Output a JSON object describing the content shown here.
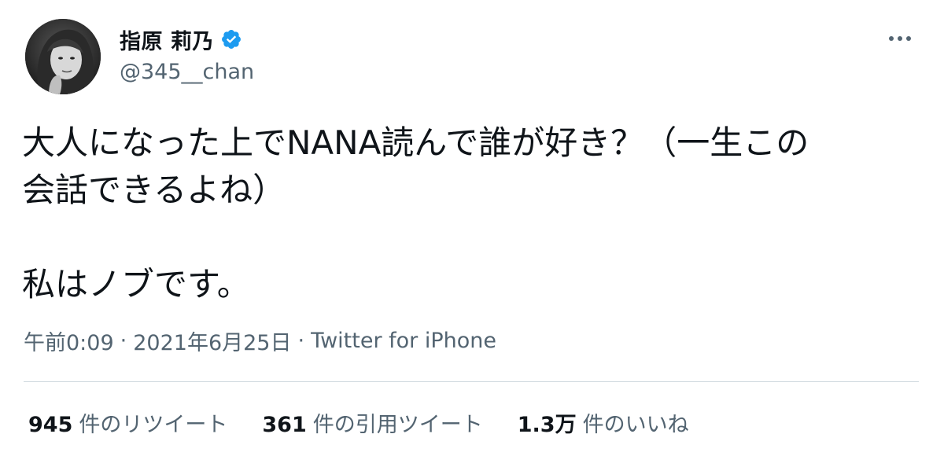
{
  "author": {
    "display_name": "指原 莉乃",
    "handle": "@345__chan",
    "verified": true,
    "avatar_icon": "profile-photo"
  },
  "colors": {
    "verified_blue": "#1d9bf0",
    "text_primary": "#0f1419",
    "text_secondary": "#536471",
    "divider": "#cfd9de"
  },
  "tweet": {
    "text": "大人になった上でNANA読んで誰が好き？（一生この\n会話できるよね）\n\n私はノブです。",
    "time": "午前0:09",
    "date": "2021年6月25日",
    "separator": "·",
    "source": "Twitter for iPhone"
  },
  "stats": [
    {
      "count": "945",
      "label": "件のリツイート"
    },
    {
      "count": "361",
      "label": "件の引用ツイート"
    },
    {
      "count": "1.3万",
      "label": "件のいいね"
    }
  ],
  "more_icon": "more-horizontal-icon"
}
